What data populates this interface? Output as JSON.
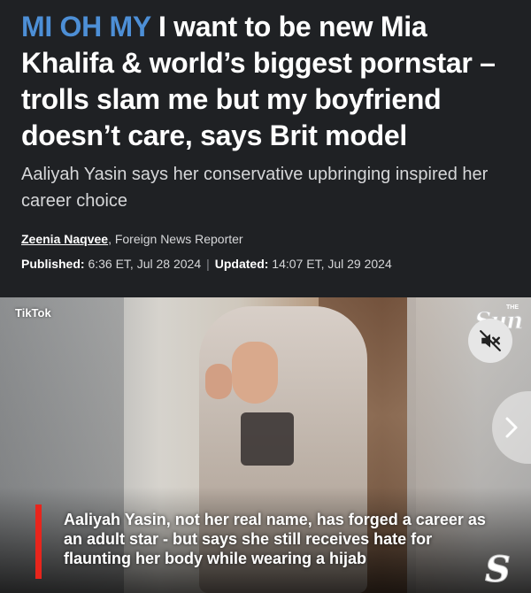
{
  "headline": {
    "kicker": "MI OH MY",
    "title": " I want to be new Mia Khalifa & world’s biggest pornstar – trolls slam me but my boyfriend doesn’t care, says Brit model"
  },
  "standfirst": "Aaliyah Yasin says her conservative upbringing inspired her career choice",
  "byline": {
    "author": "Zeenia Naqvee",
    "role": ", Foreign News Reporter"
  },
  "dates": {
    "published_label": "Published:",
    "published": " 6:36 ET, Jul 28 2024",
    "separator": "|",
    "updated_label": "Updated:",
    "updated": " 14:07 ET, Jul 29 2024"
  },
  "video": {
    "source_label": "TikTok",
    "brand_the": "THE",
    "brand_sun": "Sun",
    "brand_s": "S",
    "caption": "Aaliyah Yasin, not her real name, has forged a career as an adult star - but says she still receives hate for flaunting her body while wearing a hijab",
    "icons": {
      "mute": "speaker-muted-icon",
      "next": "chevron-right-icon"
    }
  },
  "colors": {
    "background": "#1f2124",
    "kicker": "#4d8fd6",
    "caption_bar": "#e8251c"
  }
}
